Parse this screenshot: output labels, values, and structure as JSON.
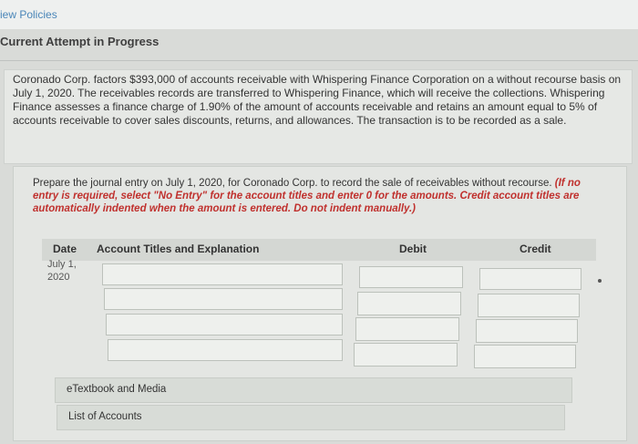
{
  "header": {
    "view_policies": "iew Policies",
    "attempt_status": "Current Attempt in Progress"
  },
  "problem": {
    "text": "Coronado Corp. factors $393,000 of accounts receivable with Whispering Finance Corporation on a without recourse basis on July 1, 2020. The receivables records are transferred to Whispering Finance, which will receive the collections. Whispering Finance assesses a finance charge of 1.90% of the amount of accounts receivable and retains an amount equal to 5% of accounts receivable to cover sales discounts, returns, and allowances. The transaction is to be recorded as a sale."
  },
  "task": {
    "instruction": "Prepare the journal entry on July 1, 2020, for Coronado Corp. to record the sale of receivables without recourse.",
    "note": "(If no entry is required, select \"No Entry\" for the account titles and enter 0 for the amounts. Credit account titles are automatically indented when the amount is entered. Do not indent manually.)"
  },
  "table": {
    "col_date": "Date",
    "col_account": "Account Titles and Explanation",
    "col_debit": "Debit",
    "col_credit": "Credit",
    "date_line1": "July 1,",
    "date_line2": "2020",
    "rows": 4
  },
  "links": {
    "etextbook": "eTextbook and Media",
    "list_of_accounts": "List of Accounts"
  }
}
